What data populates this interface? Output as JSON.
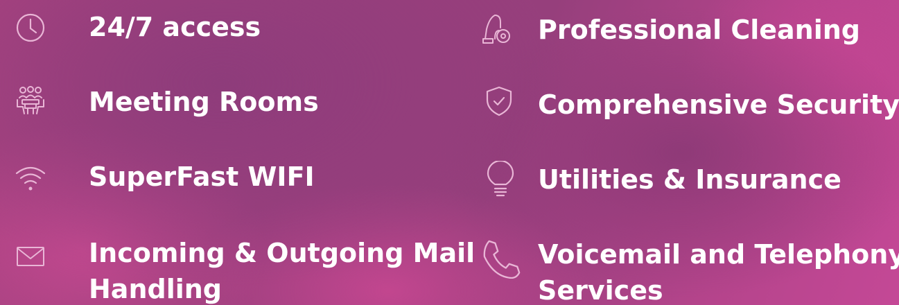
{
  "features": {
    "left": [
      {
        "icon": "clock-icon",
        "label": "24/7 access"
      },
      {
        "icon": "meeting-room-icon",
        "label": "Meeting Rooms"
      },
      {
        "icon": "wifi-icon",
        "label": "SuperFast WIFI"
      },
      {
        "icon": "mail-icon",
        "label_line1": "Incoming & Outgoing Mail",
        "label_line2": "Handling"
      }
    ],
    "right": [
      {
        "icon": "vacuum-cleaner-icon",
        "label": "Professional Cleaning"
      },
      {
        "icon": "shield-check-icon",
        "label": "Comprehensive Security"
      },
      {
        "icon": "lightbulb-icon",
        "label": "Utilities & Insurance"
      },
      {
        "icon": "phone-icon",
        "label_line1": "Voicemail and Telephony",
        "label_line2": "Services"
      }
    ]
  },
  "colors": {
    "text": "#ffffff",
    "icon_stroke": "#e9b6d6"
  }
}
